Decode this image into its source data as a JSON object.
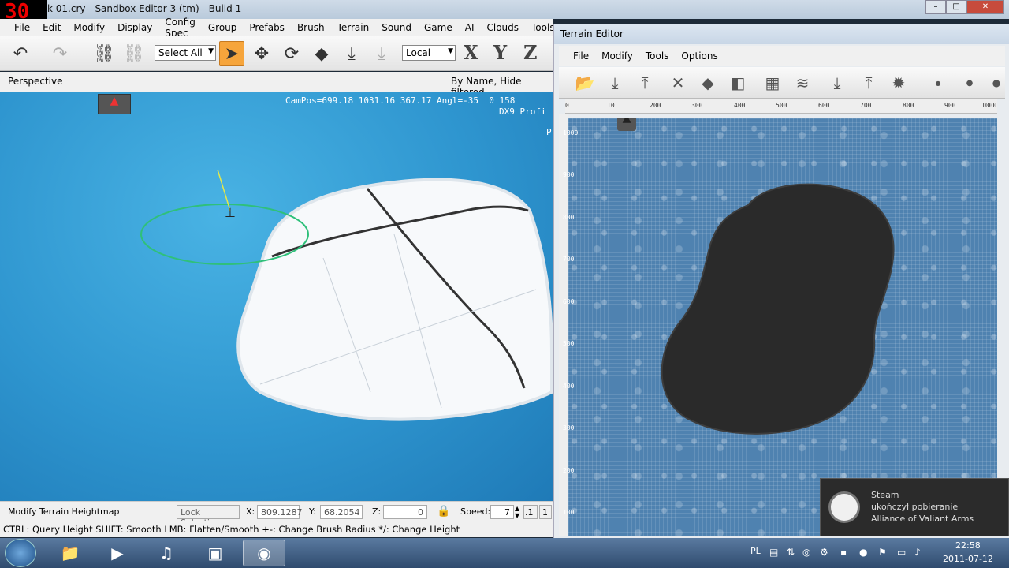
{
  "main_window": {
    "fps": "30",
    "title": "k 01.cry - Sandbox Editor 3 (tm) - Build 1",
    "menu": [
      "File",
      "Edit",
      "Modify",
      "Display",
      "Config Spec",
      "Group",
      "Prefabs",
      "Brush",
      "Terrain",
      "Sound",
      "Game",
      "AI",
      "Clouds",
      "Tools"
    ],
    "toolbar": {
      "selection_combo": "Select All",
      "coord_combo": "Local",
      "axis_x": "X",
      "axis_y": "Y",
      "axis_z": "Z"
    },
    "viewport": {
      "label": "Perspective",
      "filter": "By Name, Hide filtered",
      "campos": "CamPos=699.18 1031.16 367.17 Angl=-35  0 158",
      "renderer": "DX9 Profi",
      "p_tag": "P"
    },
    "statusbar": {
      "mode": "Modify Terrain Heightmap",
      "lock_selection": "Lock Selection",
      "x_label": "X:",
      "x_value": "809.1287",
      "y_label": "Y:",
      "y_value": "68.2054",
      "z_label": "Z:",
      "z_value": "0",
      "speed_label": "Speed:",
      "speed_value": "7",
      "speed_small": ".1",
      "speed_one": "1"
    },
    "hints": "CTRL: Query Height  SHIFT: Smooth  LMB: Flatten/Smooth  +-: Change Brush Radius  */: Change Height"
  },
  "terrain_editor": {
    "title": "Terrain Editor",
    "menu": [
      "File",
      "Modify",
      "Tools",
      "Options"
    ],
    "ruler_top": [
      "0",
      "10",
      "200",
      "300",
      "400",
      "500",
      "600",
      "700",
      "800",
      "900",
      "1000"
    ],
    "ruler_left": [
      "1000",
      "900",
      "800",
      "700",
      "600",
      "500",
      "400",
      "300",
      "200",
      "100"
    ]
  },
  "steam": {
    "title": "Steam",
    "line1": "ukończył pobieranie",
    "line2": "Alliance of Valiant Arms"
  },
  "taskbar": {
    "lang": "PL",
    "time": "22:58",
    "date": "2011-07-12"
  }
}
